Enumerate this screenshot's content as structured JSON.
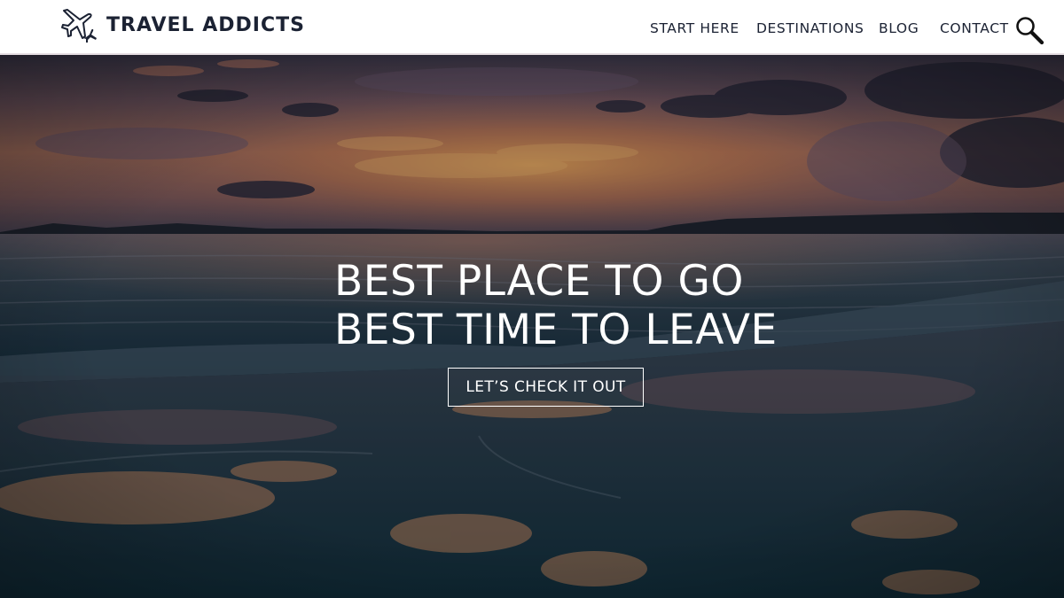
{
  "site": {
    "name": "TRAVEL ADDICTS",
    "logo_icon": "airplanes-icon"
  },
  "nav": {
    "items": [
      {
        "label": "START HERE"
      },
      {
        "label": "DESTINATIONS"
      },
      {
        "label": "BLOG"
      },
      {
        "label": "CONTACT"
      }
    ],
    "search_icon": "search-icon"
  },
  "hero": {
    "headline_line1": "BEST PLACE TO GO",
    "headline_line2": "BEST TIME TO LEAVE",
    "cta_label": "LET’S CHECK IT OUT",
    "background": "sunset-beach-photo"
  },
  "colors": {
    "header_bg": "#ffffff",
    "nav_text": "#1b2233",
    "hero_text": "#ffffff"
  }
}
